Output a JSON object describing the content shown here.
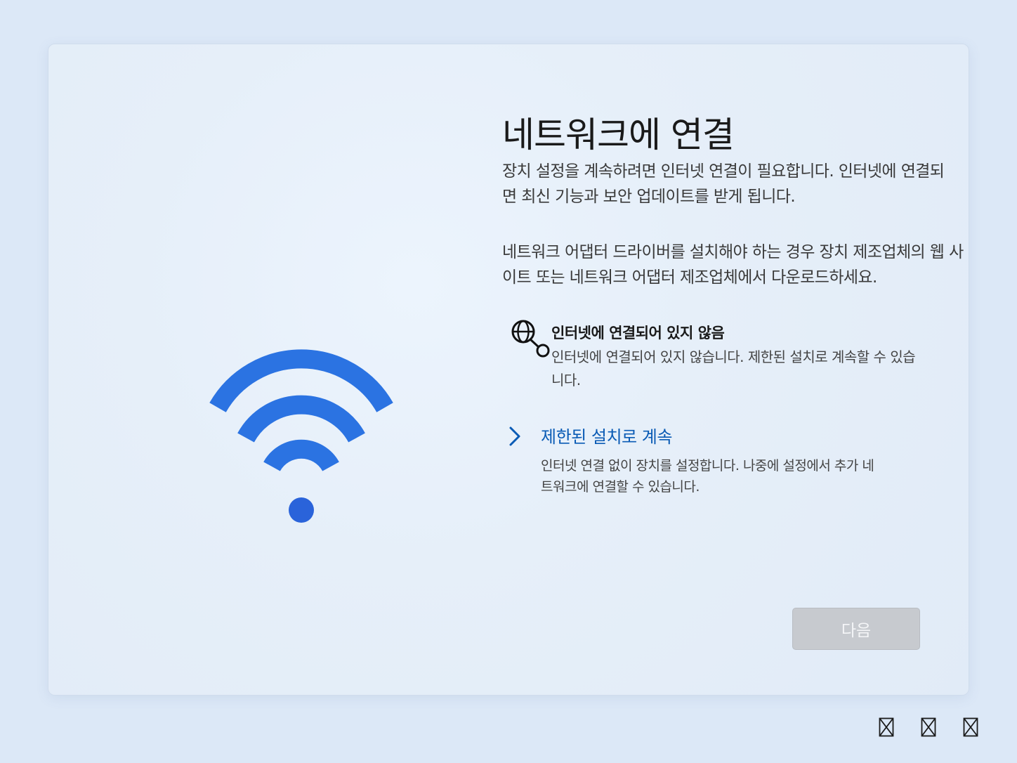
{
  "page": {
    "title": "네트워크에 연결",
    "description_1": "장치 설정을 계속하려면 인터넷 연결이 필요합니다. 인터넷에 연결되면 최신 기능과 보안 업데이트를 받게 됩니다.",
    "description_2": "네트워크 어댑터 드라이버를 설치해야 하는 경우 장치 제조업체의 웹 사이트 또는 네트워크 어댑터 제조업체에서 다운로드하세요."
  },
  "status": {
    "icon": "globe-disconnected-icon",
    "title": "인터넷에 연결되어 있지 않음",
    "description": "인터넷에 연결되어 있지 않습니다. 제한된 설치로 계속할 수 있습니다."
  },
  "limited_setup": {
    "icon": "chevron-right-icon",
    "label": "제한된 설치로 계속",
    "description": "인터넷 연결 없이 장치를 설정합니다. 나중에 설정에서 추가 네트워크에 연결할 수 있습니다."
  },
  "footer": {
    "next_label": "다음"
  },
  "tray": {
    "icons": [
      "network-icon",
      "accessibility-icon",
      "power-icon"
    ]
  },
  "colors": {
    "accent": "#2b73e2",
    "link": "#0a5bb5",
    "button_disabled": "#c7cacf"
  }
}
